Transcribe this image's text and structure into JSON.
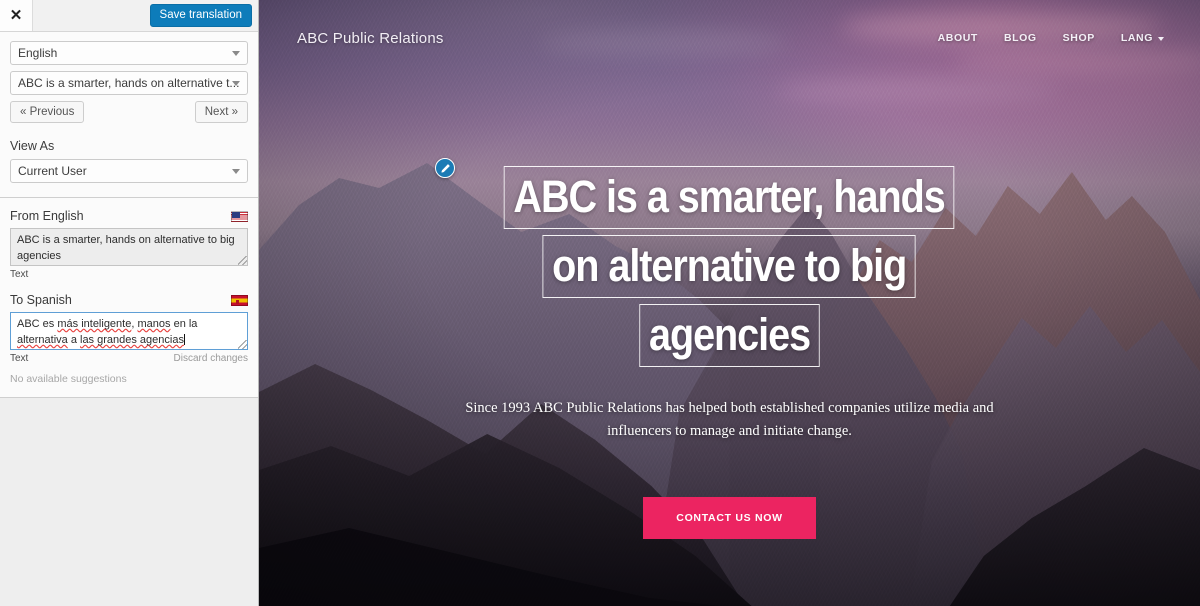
{
  "panel": {
    "close_icon": "close-icon",
    "save_label": "Save translation",
    "language_select": {
      "value": "English",
      "icon": "chevron-down-icon"
    },
    "string_select": {
      "value": "ABC is a smarter, hands on alternative t...",
      "icon": "chevron-down-icon"
    },
    "previous_label": "« Previous",
    "next_label": "Next »",
    "view_as_label": "View As",
    "view_as_select": {
      "value": "Current User",
      "icon": "chevron-down-icon"
    },
    "source": {
      "title": "From English",
      "flag": "us-flag-icon",
      "value": "ABC is a smarter, hands on alternative to big agencies",
      "meta_type": "Text"
    },
    "target": {
      "title": "To Spanish",
      "flag": "spain-flag-icon",
      "value": "ABC es más inteligente, manos en la alternativa a las grandes agencias",
      "value_parts": [
        {
          "text": "ABC es ",
          "misspelled": false
        },
        {
          "text": "más inteligente",
          "misspelled": true
        },
        {
          "text": ", ",
          "misspelled": false
        },
        {
          "text": "manos",
          "misspelled": true
        },
        {
          "text": " en la ",
          "misspelled": false
        },
        {
          "text": "alternativa",
          "misspelled": true
        },
        {
          "text": " a ",
          "misspelled": false
        },
        {
          "text": "las grandes agencias",
          "misspelled": true
        }
      ],
      "meta_type": "Text",
      "discard_label": "Discard changes",
      "suggestions_label": "No available suggestions"
    }
  },
  "site": {
    "brand": "ABC Public Relations",
    "nav": [
      {
        "label": "ABOUT",
        "has_caret": false
      },
      {
        "label": "BLOG",
        "has_caret": false
      },
      {
        "label": "SHOP",
        "has_caret": false
      },
      {
        "label": "LANG",
        "has_caret": true
      }
    ],
    "hero": {
      "edit_icon": "pencil-edit-icon",
      "headline_lines": [
        "ABC is a smarter, hands",
        "on alternative to big",
        "agencies"
      ],
      "subtitle": "Since 1993 ABC Public Relations has helped both established companies utilize media and influencers to manage and initiate change.",
      "cta_label": "CONTACT US NOW"
    }
  },
  "colors": {
    "save_button": "#0d7cba",
    "cta_pink": "#ec2461",
    "edit_badge_blue": "#1b7bb5",
    "panel_background": "#eeeeee",
    "focus_border": "#5f9fd6",
    "spellcheck_underline": "#e8423f"
  }
}
